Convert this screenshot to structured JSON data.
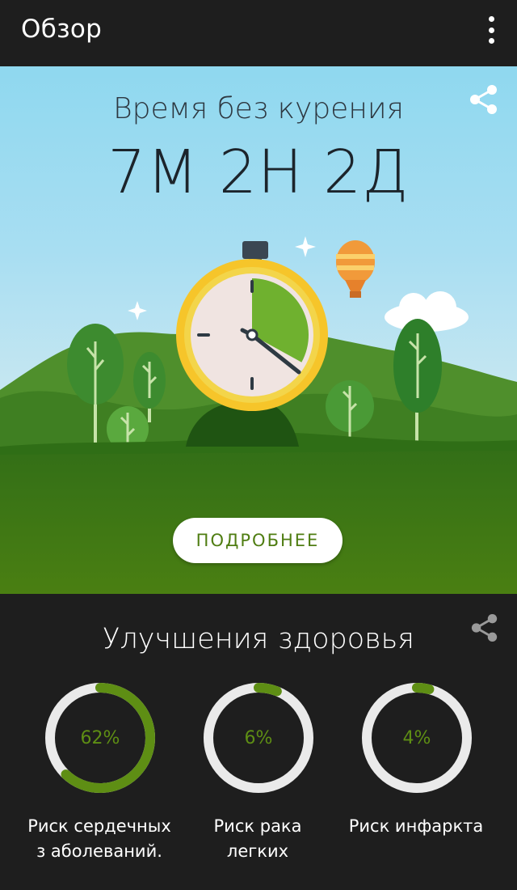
{
  "app_bar": {
    "title": "Обзор",
    "menu_icon": "more-vert-icon"
  },
  "hero": {
    "label": "Время без курения",
    "value": "7М 2Н 2Д",
    "share_icon": "share-icon",
    "details_button": "ПОДРОБНЕЕ",
    "stopwatch_progress": 0.33
  },
  "health": {
    "title": "Улучшения здоровья",
    "share_icon": "share-icon",
    "metrics": [
      {
        "value_text": "62%",
        "progress": 0.62,
        "label": "Риск сердечных з аболеваний."
      },
      {
        "value_text": "6%",
        "progress": 0.06,
        "label": "Риск рака легких"
      },
      {
        "value_text": "4%",
        "progress": 0.04,
        "label": "Риск инфаркта"
      }
    ]
  },
  "colors": {
    "background": "#1e1e1e",
    "accent_green": "#5e8e14",
    "ring_track": "#eaeaea",
    "button_text": "#4f7d12"
  }
}
